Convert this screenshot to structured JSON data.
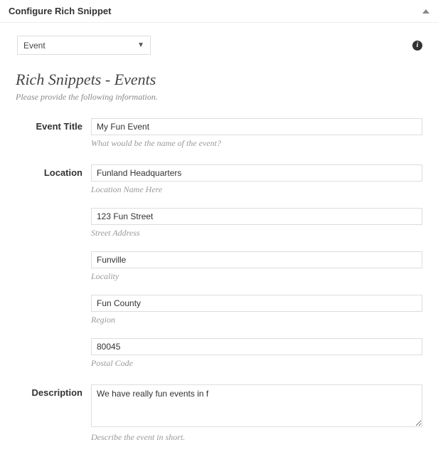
{
  "panel": {
    "title": "Configure Rich Snippet"
  },
  "selector": {
    "selected": "Event"
  },
  "section": {
    "title": "Rich Snippets - Events",
    "subtitle": "Please provide the following information."
  },
  "form": {
    "event_title": {
      "label": "Event Title",
      "value": "My Fun Event",
      "hint": "What would be the name of the event?"
    },
    "location": {
      "label": "Location",
      "name": {
        "value": "Funland Headquarters",
        "hint": "Location Name Here"
      },
      "street": {
        "value": "123 Fun Street",
        "hint": "Street Address"
      },
      "locality": {
        "value": "Funville",
        "hint": "Locality"
      },
      "region": {
        "value": "Fun County",
        "hint": "Region"
      },
      "postal": {
        "value": "80045",
        "hint": "Postal Code"
      }
    },
    "description": {
      "label": "Description",
      "value": "We have really fun events in f",
      "hint": "Describe the event in short."
    }
  }
}
